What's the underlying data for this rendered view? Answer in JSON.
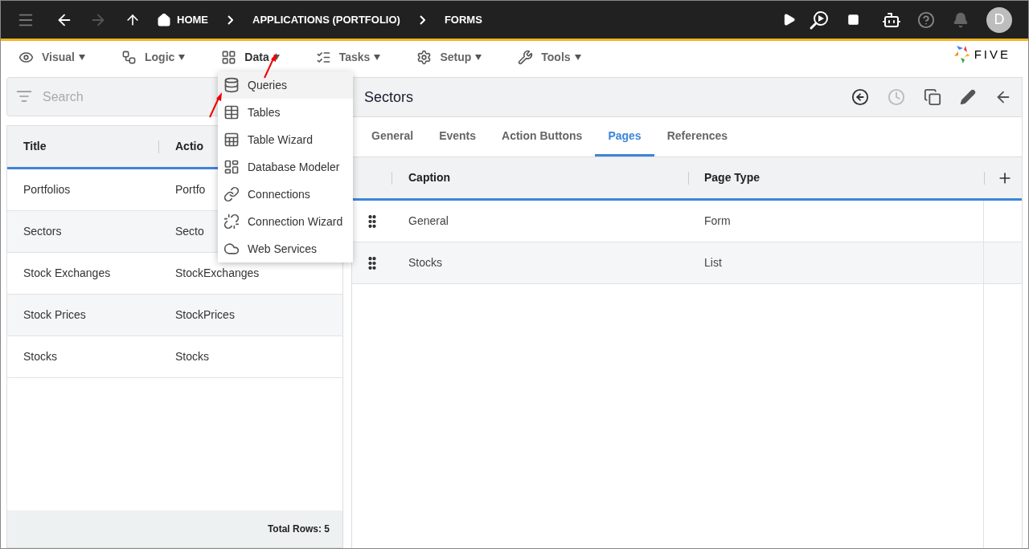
{
  "top_bar": {
    "breadcrumbs": [
      {
        "label": "HOME",
        "kind": "home"
      },
      {
        "label": "APPLICATIONS (PORTFOLIO)",
        "kind": "plain"
      },
      {
        "label": "FORMS",
        "kind": "plain"
      }
    ],
    "avatar": "D"
  },
  "menu_bar": {
    "items": [
      {
        "label": "Visual",
        "open": false
      },
      {
        "label": "Logic",
        "open": false
      },
      {
        "label": "Data",
        "open": true
      },
      {
        "label": "Tasks",
        "open": false
      },
      {
        "label": "Setup",
        "open": false
      },
      {
        "label": "Tools",
        "open": false
      }
    ],
    "logo": "FIVE"
  },
  "data_menu": [
    {
      "label": "Queries",
      "selected": true
    },
    {
      "label": "Tables",
      "selected": false
    },
    {
      "label": "Table Wizard",
      "selected": false
    },
    {
      "label": "Database Modeler",
      "selected": false
    },
    {
      "label": "Connections",
      "selected": false
    },
    {
      "label": "Connection Wizard",
      "selected": false
    },
    {
      "label": "Web Services",
      "selected": false
    }
  ],
  "list_panel": {
    "search": {
      "placeholder": "Search"
    },
    "columns": [
      "Title",
      "Actio"
    ],
    "rows": [
      [
        "Portfolios",
        "Portfo"
      ],
      [
        "Sectors",
        "Secto"
      ],
      [
        "Stock Exchanges",
        "StockExchanges"
      ],
      [
        "Stock Prices",
        "StockPrices"
      ],
      [
        "Stocks",
        "Stocks"
      ]
    ],
    "total": "Total Rows: 5"
  },
  "detail_panel": {
    "title": "Sectors",
    "tabs": [
      {
        "label": "General",
        "selected": false
      },
      {
        "label": "Events",
        "selected": false
      },
      {
        "label": "Action Buttons",
        "selected": false
      },
      {
        "label": "Pages",
        "selected": true
      },
      {
        "label": "References",
        "selected": false
      }
    ],
    "columns": [
      "Caption",
      "Page Type"
    ],
    "rows": [
      [
        "General",
        "Form"
      ],
      [
        "Stocks",
        "List"
      ]
    ]
  }
}
